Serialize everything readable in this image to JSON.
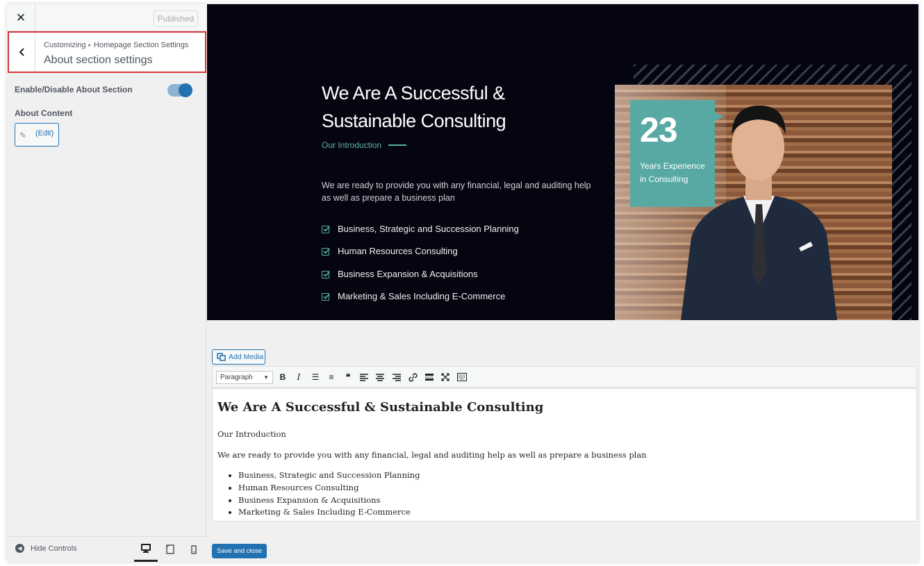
{
  "sidebar": {
    "close_label": "✕",
    "published_label": "Published",
    "breadcrumb": {
      "root": "Customizing",
      "separator": "▸",
      "parent": "Homepage Section Settings"
    },
    "section_title": "About section settings",
    "toggle_label": "Enable/Disable About Section",
    "toggle_on": true,
    "content_label": "About Content",
    "edit_label": "(Edit)",
    "footer": {
      "hide_controls_label": "Hide Controls",
      "devices": [
        "desktop-icon",
        "tablet-icon",
        "mobile-icon"
      ]
    }
  },
  "preview": {
    "title": "We Are A Successful & Sustainable Consulting",
    "intro": "Our Introduction",
    "description": "We are ready to provide you with any financial, legal and auditing help as well as prepare a business plan",
    "list": [
      "Business, Strategic and Succession Planning",
      "Human Resources Consulting",
      "Business Expansion & Acquisitions",
      "Marketing & Sales Including E-Commerce"
    ],
    "badge_number": "23",
    "badge_text": "Years Experience in Consulting",
    "accent_color": "#58a9a4"
  },
  "editor": {
    "add_media_label": "Add Media",
    "format_select": "Paragraph",
    "toolbar_icons": [
      "bold-icon",
      "italic-icon",
      "bullet-list-icon",
      "numbered-list-icon",
      "blockquote-icon",
      "align-left-icon",
      "align-center-icon",
      "align-right-icon",
      "link-icon",
      "read-more-icon",
      "fullscreen-icon",
      "toolbar-toggle-icon"
    ],
    "heading": "We Are A Successful & Sustainable Consulting",
    "intro": "Our Introduction",
    "description": "We are ready to provide you with any financial, legal and auditing help as well as prepare a business plan",
    "list": [
      "Business, Strategic and Succession Planning",
      "Human Resources Consulting",
      "Business Expansion & Acquisitions",
      "Marketing & Sales Including E-Commerce"
    ],
    "save_label": "Save and close"
  }
}
